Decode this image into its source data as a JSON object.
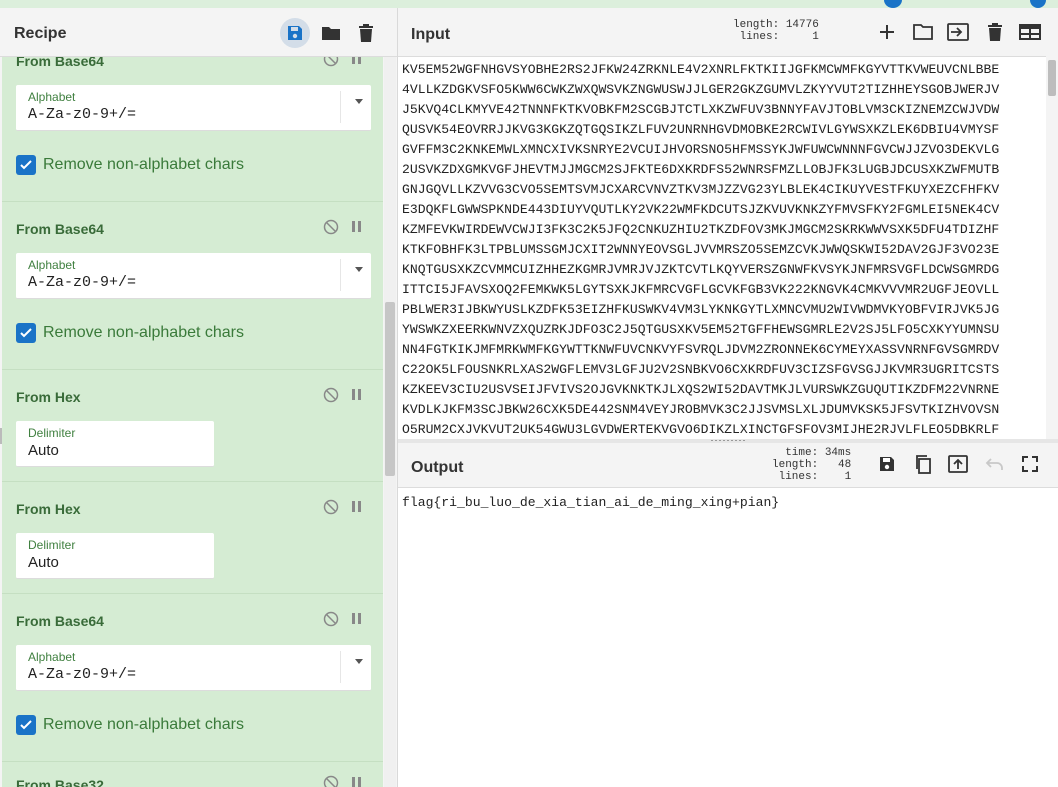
{
  "recipe": {
    "title": "Recipe",
    "header_icons": [
      "save-icon",
      "folder-icon",
      "trash-icon"
    ],
    "operations": [
      {
        "name": "From Base64",
        "field_label": "Alphabet",
        "field_value": "A-Za-z0-9+/=",
        "checkbox_label": "Remove non-alphabet chars",
        "checked": true
      },
      {
        "name": "From Base64",
        "field_label": "Alphabet",
        "field_value": "A-Za-z0-9+/=",
        "checkbox_label": "Remove non-alphabet chars",
        "checked": true
      },
      {
        "name": "From Hex",
        "field_label": "Delimiter",
        "field_value": "Auto"
      },
      {
        "name": "From Hex",
        "field_label": "Delimiter",
        "field_value": "Auto"
      },
      {
        "name": "From Base64",
        "field_label": "Alphabet",
        "field_value": "A-Za-z0-9+/=",
        "checkbox_label": "Remove non-alphabet chars",
        "checked": true
      },
      {
        "name": "From Base32"
      }
    ]
  },
  "input": {
    "title": "Input",
    "length_label": "length:",
    "length_value": "14776",
    "lines_label": "lines:",
    "lines_value": "1",
    "lines": [
      "KV5EM52WGFNHGVSYOBHE2RS2JFKW24ZRKNLE4V2XNRLFKTKIIJGFKMCWMFKGYVTTKVWEUVCNLBBE",
      "4VLLKZDGKVSFO5KWW6CWKZWXQWSVKZNGWUSWJJLGER2GKZGUMVLZKYYVUT2TIZHHEYSGOBJWERJV",
      "J5KVQ4CLKMYVE42TNNNFKTKVOBKFM2SCGBJTCTLXKZWFUV3BNNYFAVJTOBLVM3CKIZNEMZCWJVDW",
      "QUSVK54EOVRRJJKVG3KGKZQTGQSIKZLFUV2UNRNHGVDMOBKE2RCWIVLGYWSXKZLEK6DBIU4VMYSF",
      "GVFFM3C2KNKEMWLXMNCXIVKSNRYE2VCUIJHVORSNO5HFMSSYKJWFUWCWNNNFGVCWJJZVO3DEKVLG",
      "2USVKZDXGMKVGFJHEVTMJJMGCM2SJFKTE6DXKRDFS52WNRSFMZLLOBJFK3LUGBJDCUSXKZWFMUTB",
      "GNJGQVLLKZVVG3CVO5SEMTSVMJCXARCVNVZTKV3MJZZVG23YLBLEK4CIKUYVESTFKUYXEZCFHFKV",
      "E3DQKFLGWWSPKNDE443DIUYVQUTLKY2VK22WMFKDCUTSJZKVUVKNKZYFMVSFKY2FGMLEI5NEK4CV",
      "KZMFEVKWIRDEWVCWJI3FK3C2K5JFQ2CNKUZHIU2TKZDFOV3MKJMGCM2SKRKWWVSXK5DFU4TDIZHF",
      "KTKFOBHFK3LTPBLUMSSGMJCXIT2WNNYEOVSGLJVVMRSZO5SEMZCVKJWWQSKWI52DAV2GJF3VO23E",
      "KNQTGUSXKZCVMMCUIZHHEZKGMRJVMRJVJZKTCVTLKQYVERSZGNWFKVSYKJNFMRSVGFLDCWSGMRDG",
      "ITTCI5JFAVSXOQ2FEMKWK5LGYTSXKJKFMRCVGFLGCVKFGB3VK222KNGVK4CMKVVVMR2UGFJEOVLL",
      "PBLWER3IJBKWYUSLKZDFK53EIZHFKUSWKV4VM3LYKNKGYTLXMNCVMU2WIVWDMVKYOBFVIRJVK5JG",
      "YWSWKZXEERKWNVZXQUZRKJDFO3C2J5QTGUSXKV5EM52TGFFHEWSGMRLE2V2SJ5LFO5CXKYYUMNSU",
      "NN4FGTKIKJMFMRKWMFKGYWTTKNWFUVCNKVYFSVRQLJDVM2ZRONNEK6CYMEYXASSVNRNFGVSGMRDV",
      "C22OK5LFOUSNKRLXAS2WGFLEMV3LGFJU2V2SNBKVO6CXKRDFUV3CIZSFGVSGJJKVMR3UGRITCSTS",
      "KZKEEV3CIU2USVSEIJFVIVS2OJGVKNKTKJLXQS2WI52DAVTMKJLVURSWKZGUQUTIKZDFM22VNRNE",
      "KVDLKJKFM3SCJBKW26CXK5DE442SNM4VEYJROBMVK3C2JJSVMSLXLJDUMVKSK5JFSVTKIZHVOVSN",
      "O5RUM2CXJVKVUT2UK54GWU3LGVDWERTEKVGVO6DIKZLXINCTGFSFOV3MIJHE2RJVLFLEO5DBKRLF"
    ]
  },
  "output": {
    "title": "Output",
    "time_label": "time:",
    "time_value": "34ms",
    "length_label": "length:",
    "length_value": "48",
    "lines_label": "lines:",
    "lines_value": "1",
    "text": "flag{ri_bu_luo_de_xia_tian_ai_de_ming_xing+pian}"
  },
  "colors": {
    "operation_bg": "#d5ecd3",
    "operation_text": "#396b39",
    "accent": "#1a73c7"
  }
}
